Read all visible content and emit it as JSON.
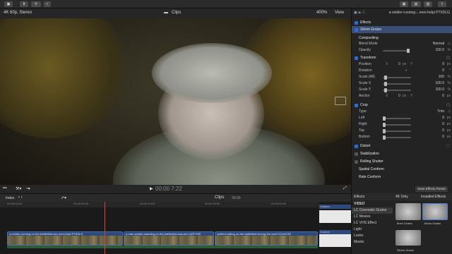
{
  "viewer": {
    "format": "4K 60p, Stereo",
    "title": "Clips",
    "zoom": "400%",
    "view_label": "View",
    "timecode": "00:00 7:22"
  },
  "inspector": {
    "clip_name": "a-soldier-running-...men-helpi P7XDLG",
    "effects_label": "Effects",
    "effect_name": "16mm Grains",
    "compositing": "Compositing",
    "blend_mode_label": "Blend Mode",
    "blend_mode_value": "Normal",
    "opacity_label": "Opacity",
    "opacity_value": "100.0",
    "opacity_unit": "%",
    "transform": "Transform",
    "position_label": "Position",
    "position_x_label": "X",
    "position_x": "0",
    "position_x_unit": "px",
    "position_y_label": "Y",
    "position_y": "0",
    "rotation_label": "Rotation",
    "rotation_value": "0",
    "rotation_unit": "°",
    "scale_all_label": "Scale (All)",
    "scale_all_value": "100",
    "scale_all_unit": "%",
    "scale_x_label": "Scale X",
    "scale_x_value": "100.0",
    "scale_x_unit": "%",
    "scale_y_label": "Scale Y",
    "scale_y_value": "100.0",
    "scale_y_unit": "%",
    "anchor_label": "Anchor",
    "anchor_x_label": "X",
    "anchor_x": "0",
    "anchor_x_unit": "px",
    "anchor_y_label": "Y",
    "anchor_y": "0",
    "crop": "Crop",
    "type_label": "Type",
    "type_value": "Trim",
    "left_label": "Left",
    "left_value": "0",
    "right_label": "Right",
    "right_value": "0",
    "top_label": "Top",
    "top_value": "0",
    "bottom_label": "Bottom",
    "bottom_value": "0",
    "px_unit": "px",
    "distort": "Distort",
    "stabilization": "Stabilization",
    "rolling_shutter": "Rolling Shutter",
    "spatial_conform": "Spatial Conform",
    "rate_conform": "Rate Conform",
    "save_preset": "Save Effects Preset"
  },
  "timeline": {
    "index_label": "Index",
    "title": "Clips",
    "duration": "30:00",
    "ruler": [
      "00:00:00:00",
      "00:00:05:00",
      "00:00:10:00",
      "00:00:15:00",
      "00:00:20:00",
      "00:00:25:00"
    ],
    "clips": [
      "a-soldier-running-on-the-battlefield-two-men-helpi P7XDLG",
      "a-man-soldier-standing-on-the-battlefield-and-aim L8RFH2E",
      "soldiers-falling-on-the-battlefield-during-the-war2-D2zKG4E"
    ],
    "mini_label_1": "Custom",
    "mini_label_2": "Custom"
  },
  "effects_browser": {
    "title": "Effects",
    "filter_4k": "4K Only",
    "installed": "Installed Effects",
    "categories": [
      "VIDEO",
      "LC Cinematic Grains",
      "LC Movies",
      "LC VHS Effect",
      "Light",
      "Looks",
      "Masks"
    ],
    "thumbs": [
      "8mm Grains",
      "16mm Grains",
      "35mm Grains"
    ]
  },
  "toolbar": {
    "share_label": "Share"
  }
}
